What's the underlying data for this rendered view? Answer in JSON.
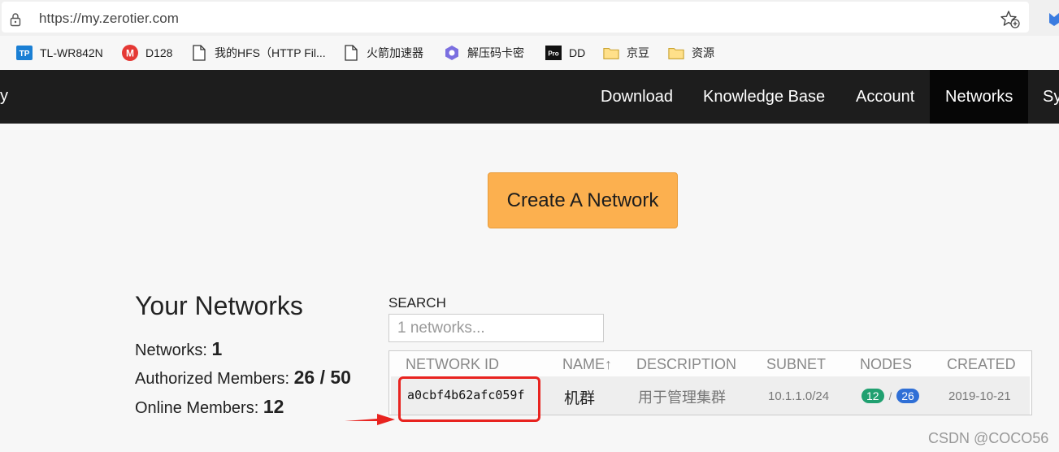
{
  "browser": {
    "url": "https://my.zerotier.com",
    "icons": {
      "lock": "lock-icon",
      "favorite": "star-plus-icon"
    }
  },
  "bookmarks": [
    {
      "label": "TL-WR842N",
      "icon": "tp-link-icon"
    },
    {
      "label": "D128",
      "icon": "m-logo-icon"
    },
    {
      "label": "我的HFS（HTTP Fil...",
      "icon": "page-icon"
    },
    {
      "label": "火箭加速器",
      "icon": "page-icon"
    },
    {
      "label": "解压码卡密",
      "icon": "hexagon-icon"
    },
    {
      "label": "DD",
      "icon": "pro-icon"
    },
    {
      "label": "京豆",
      "icon": "folder-icon"
    },
    {
      "label": "资源",
      "icon": "folder-icon"
    }
  ],
  "nav": {
    "edge_left": "y",
    "items": [
      {
        "label": "Download",
        "active": false
      },
      {
        "label": "Knowledge Base",
        "active": false
      },
      {
        "label": "Account",
        "active": false
      },
      {
        "label": "Networks",
        "active": true
      },
      {
        "label": "Sy",
        "active": false
      }
    ]
  },
  "main": {
    "create_button": "Create A Network",
    "summary": {
      "title": "Your Networks",
      "networks_label": "Networks:",
      "networks_value": "1",
      "authorized_label": "Authorized Members:",
      "authorized_value": "26 / 50",
      "online_label": "Online Members:",
      "online_value": "12"
    },
    "search": {
      "label": "SEARCH",
      "placeholder": "1 networks..."
    },
    "table": {
      "headers": [
        "NETWORK ID",
        "NAME↑",
        "DESCRIPTION",
        "SUBNET",
        "NODES",
        "CREATED"
      ],
      "rows": [
        {
          "id": "a0cbf4b62afc059f",
          "name": "机群",
          "description": "用于管理集群",
          "subnet": "10.1.1.0/24",
          "nodes_online": "12",
          "nodes_sep": "/",
          "nodes_total": "26",
          "created": "2019-10-21"
        }
      ]
    }
  },
  "annotation": {
    "highlight_color": "#e8231f",
    "arrow_color": "#e8231f"
  },
  "watermark": "CSDN @COCO56",
  "colors": {
    "nav_bg": "#1d1d1d",
    "nav_active_bg": "#060606",
    "create_button": "#fcb04f",
    "badge_online": "#20a070",
    "badge_total": "#2f6fd6"
  }
}
